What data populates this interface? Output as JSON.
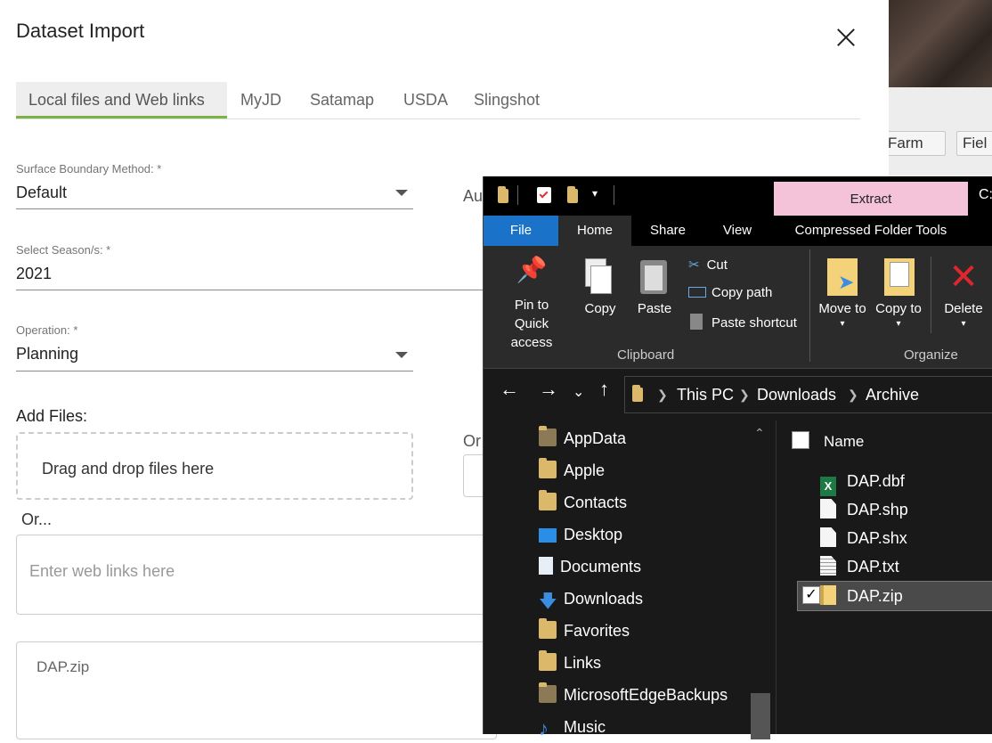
{
  "dialog": {
    "title": "Dataset Import",
    "tabs": [
      "Local files and Web links",
      "MyJD",
      "Satamap",
      "USDA",
      "Slingshot"
    ],
    "surface_label": "Surface Boundary Method: *",
    "surface_value": "Default",
    "auto_label_partial": "Au",
    "season_label": "Select Season/s: *",
    "season_value": "2021",
    "operation_label": "Operation: *",
    "operation_value": "Planning",
    "add_files_label": "Add Files:",
    "drop_text": "Drag and drop files here",
    "or_partial": "Or",
    "or_text": "Or...",
    "weblinks_placeholder": "Enter web links here",
    "selected_file": "DAP.zip",
    "accent_color": "#7cb342"
  },
  "background": {
    "buttons": [
      "Farm",
      "Fiel"
    ]
  },
  "explorer": {
    "title_partial": "C:\\",
    "context_tab": "Extract",
    "context_tab_color": "#f4c3d9",
    "ribbon_tabs": [
      "File",
      "Home",
      "Share",
      "View",
      "Compressed Folder Tools"
    ],
    "ribbon": {
      "pin": "Pin to Quick access",
      "copy": "Copy",
      "paste": "Paste",
      "cut": "Cut",
      "copy_path": "Copy path",
      "paste_shortcut": "Paste shortcut",
      "clipboard_group": "Clipboard",
      "move_to": "Move to",
      "copy_to": "Copy to",
      "delete": "Delete",
      "organize_group": "Organize"
    },
    "breadcrumb": [
      "This PC",
      "Downloads",
      "Archive"
    ],
    "nav_items": [
      {
        "label": "AppData",
        "icon": "folder-dark-icon"
      },
      {
        "label": "Apple",
        "icon": "folder-icon"
      },
      {
        "label": "Contacts",
        "icon": "contacts-folder-icon"
      },
      {
        "label": "Desktop",
        "icon": "desktop-icon"
      },
      {
        "label": "Documents",
        "icon": "documents-icon"
      },
      {
        "label": "Downloads",
        "icon": "downloads-icon"
      },
      {
        "label": "Favorites",
        "icon": "favorites-folder-icon"
      },
      {
        "label": "Links",
        "icon": "links-folder-icon"
      },
      {
        "label": "MicrosoftEdgeBackups",
        "icon": "folder-dark-icon"
      },
      {
        "label": "Music",
        "icon": "music-icon"
      }
    ],
    "column_header": "Name",
    "files": [
      {
        "name": "DAP.dbf",
        "icon": "excel-file-icon",
        "selected": false
      },
      {
        "name": "DAP.shp",
        "icon": "file-icon",
        "selected": false
      },
      {
        "name": "DAP.shx",
        "icon": "file-icon",
        "selected": false
      },
      {
        "name": "DAP.txt",
        "icon": "text-file-icon",
        "selected": false
      },
      {
        "name": "DAP.zip",
        "icon": "zip-file-icon",
        "selected": true
      }
    ]
  }
}
